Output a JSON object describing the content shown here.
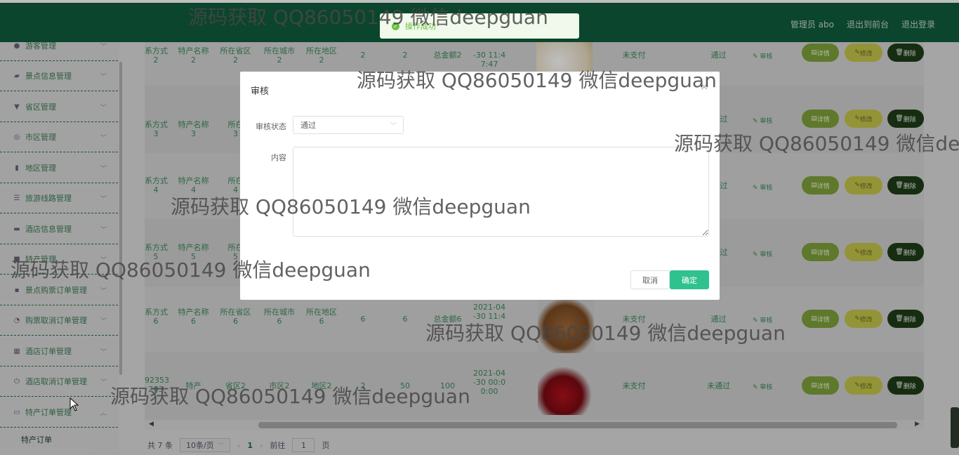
{
  "header": {
    "admin_label": "管理员 abo",
    "to_front": "退出到前台",
    "logout": "退出登录"
  },
  "sidebar": {
    "items": [
      {
        "label": "游客管理",
        "icon": "user-icon"
      },
      {
        "label": "景点信息管理",
        "icon": "ticket-icon"
      },
      {
        "label": "省区管理",
        "icon": "flag-icon"
      },
      {
        "label": "市区管理",
        "icon": "globe-icon"
      },
      {
        "label": "地区管理",
        "icon": "bar-chart-icon"
      },
      {
        "label": "旅游线路管理",
        "icon": "list-icon"
      },
      {
        "label": "酒店信息管理",
        "icon": "monitor-icon"
      },
      {
        "label": "特产管理",
        "icon": "gift-icon"
      },
      {
        "label": "景点购票订单管理",
        "icon": "bag-icon"
      },
      {
        "label": "购票取消订单管理",
        "icon": "cancel-icon"
      },
      {
        "label": "酒店订单管理",
        "icon": "grid-icon"
      },
      {
        "label": "酒店取消订单管理",
        "icon": "power-icon"
      },
      {
        "label": "特产订单管理",
        "icon": "chat-icon"
      }
    ],
    "sub_item": "特产订单"
  },
  "table": {
    "rows": [
      {
        "contact": "系方式\n2",
        "name": "特产名称\n2",
        "province": "所在省区\n2",
        "city": "所在城市\n2",
        "area": "所在地区\n2",
        "price": "2",
        "qty": "2",
        "total": "总金额2",
        "date": "-30 11:4\n7:47",
        "pay": "未支付",
        "status": "通过",
        "audit": "审核"
      },
      {
        "contact": "系方式\n3",
        "name": "特产名称\n3",
        "province": "所在\n3",
        "city": "",
        "area": "",
        "price": "",
        "qty": "",
        "total": "",
        "date": "",
        "pay": "",
        "status": "过",
        "audit": "审核"
      },
      {
        "contact": "系方式\n4",
        "name": "特产名称\n4",
        "province": "所在\n4",
        "city": "",
        "area": "",
        "price": "",
        "qty": "",
        "total": "",
        "date": "",
        "pay": "",
        "status": "过",
        "audit": "审核"
      },
      {
        "contact": "系方式\n5",
        "name": "特产名称\n5",
        "province": "所在\n5",
        "city": "",
        "area": "",
        "price": "",
        "qty": "",
        "total": "",
        "date": "",
        "pay": "",
        "status": "过",
        "audit": "审核"
      },
      {
        "contact": "系方式\n6",
        "name": "特产名称\n6",
        "province": "所在省区\n6",
        "city": "所在城市\n6",
        "area": "所在地区\n6",
        "price": "6",
        "qty": "6",
        "total": "总金额6",
        "date": "2021-04\n-30 11:4",
        "pay": "未支付",
        "status": "通过",
        "audit": "审核"
      },
      {
        "contact": "92353\n203",
        "name": "特产",
        "province": "省区2",
        "city": "市区2",
        "area": "地区2",
        "price": "2",
        "qty": "50",
        "total": "100",
        "date": "2021-04\n-30 00:0\n0:00",
        "pay": "未支付",
        "status": "未通过",
        "audit": "审核"
      }
    ],
    "btn_detail": "详情",
    "btn_edit": "修改",
    "btn_delete": "删除"
  },
  "pager": {
    "total": "共 7 条",
    "size": "10条/页",
    "page": "1",
    "goto_prefix": "前往",
    "goto_value": "1",
    "goto_suffix": "页"
  },
  "toast": {
    "message": "操作成功"
  },
  "dialog": {
    "title": "审核",
    "status_label": "审核状态",
    "status_value": "通过",
    "content_label": "内容",
    "content_value": "",
    "cancel": "取消",
    "confirm": "确定"
  },
  "watermark": "源码获取 QQ86050149 微信deepguan"
}
